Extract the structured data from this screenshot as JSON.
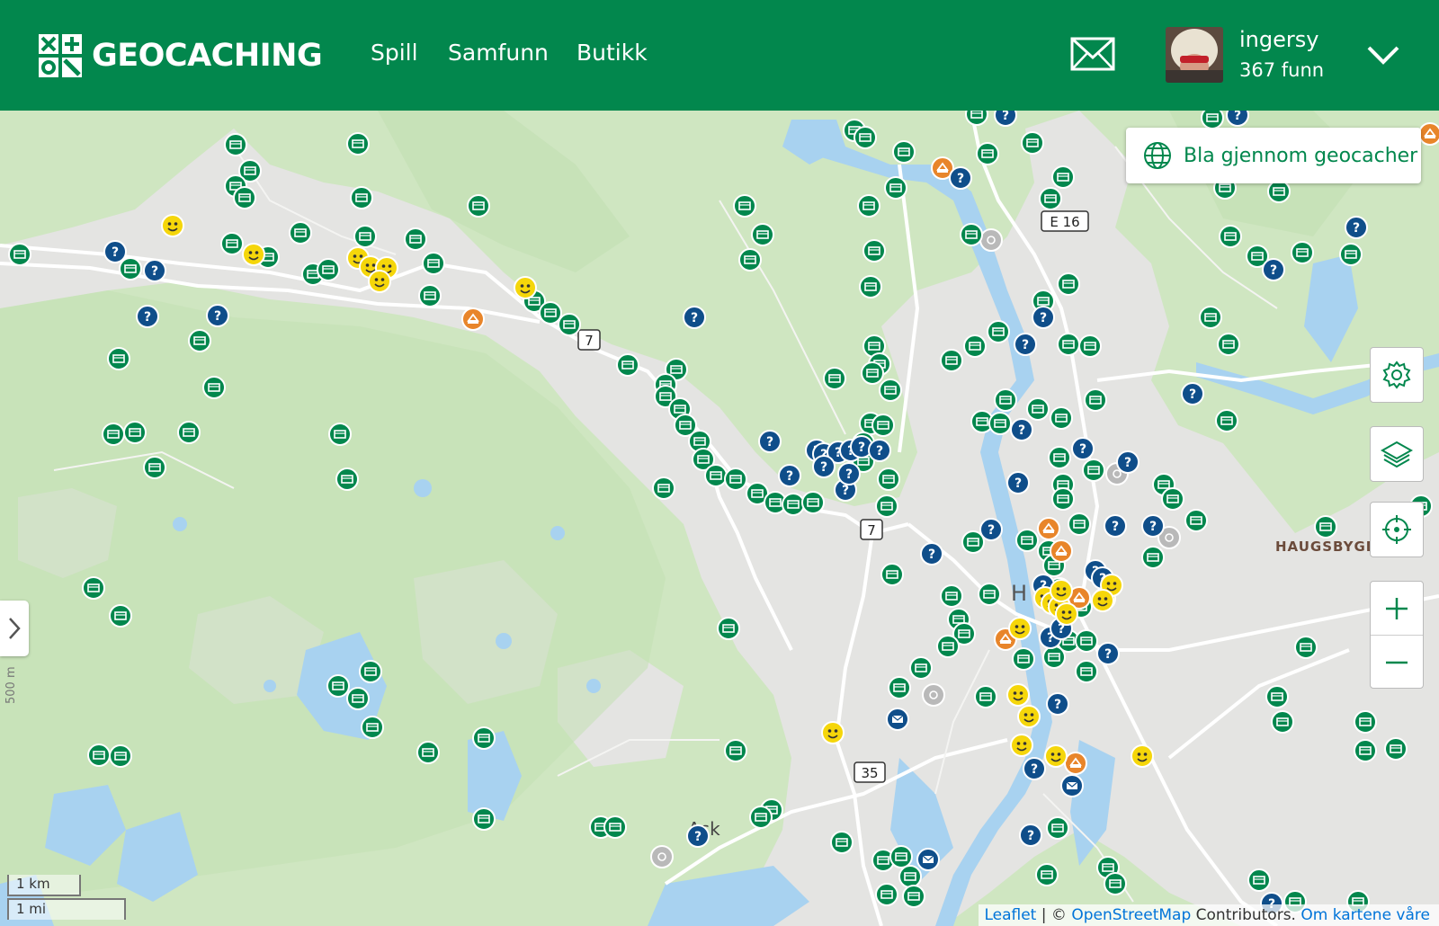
{
  "header": {
    "logo_text": "GEOCACHING",
    "nav": [
      {
        "label": "Spill"
      },
      {
        "label": "Samfunn"
      },
      {
        "label": "Butikk"
      }
    ],
    "username": "ingersy",
    "finds": "367 funn"
  },
  "map": {
    "browse_button": "Bla gjennom geocacher",
    "places": {
      "ask": "Ask",
      "haugsbygd": "HAUGSBYGD",
      "town_partial": "H"
    },
    "roads": {
      "e16": "E 16",
      "r7a": "7",
      "r7b": "7",
      "r35": "35"
    },
    "scale_km": "1 km",
    "scale_mi": "1 mi",
    "side_scale": "500 m",
    "attribution": {
      "leaflet": "Leaflet",
      "separator": " | © ",
      "osm": "OpenStreetMap",
      "contributors": " Contributors. ",
      "about": "Om kartene våre"
    }
  },
  "colors": {
    "brand_green": "#02874d",
    "traditional": "#02874d",
    "mystery": "#0f4e8a",
    "multi": "#e8852a",
    "event": "#f5d60a",
    "forest": "#c4e2b4",
    "water": "#a8d2f0",
    "urban": "#e4e4e2"
  },
  "icons": {
    "traditional": "traditional-cache-icon",
    "mystery": "mystery-cache-icon",
    "multi": "multi-cache-icon",
    "event": "event-cache-icon",
    "letterbox": "letterbox-cache-icon"
  }
}
